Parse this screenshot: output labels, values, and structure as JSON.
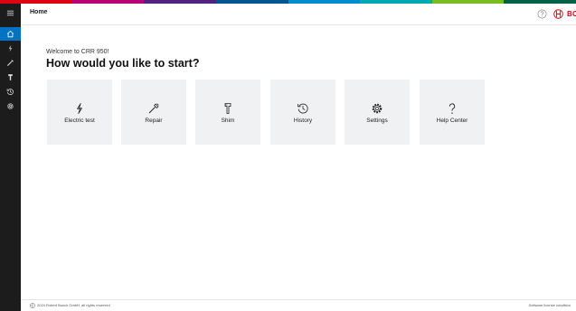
{
  "header": {
    "title": "Home",
    "brand": "BOSCH"
  },
  "brand_colors": {
    "bar": [
      "#e20015",
      "#b90276",
      "#50237f",
      "#005691",
      "#008ecf",
      "#00a8b0",
      "#78be20",
      "#006249"
    ],
    "rail_bg": "#1c1c1c",
    "rail_active": "#0072c3",
    "tile_bg": "#eff1f2",
    "logo_red": "#e20015"
  },
  "sidebar": {
    "items": [
      {
        "icon": "menu-icon"
      },
      {
        "icon": "home-icon",
        "active": true
      },
      {
        "icon": "lightning-icon"
      },
      {
        "icon": "repair-icon"
      },
      {
        "icon": "shim-icon"
      },
      {
        "icon": "history-icon"
      },
      {
        "icon": "settings-icon"
      }
    ]
  },
  "main": {
    "welcome": "Welcome to CRR 950!",
    "headline": "How would you like to start?",
    "tiles": [
      {
        "label": "Electric test",
        "icon": "lightning-icon"
      },
      {
        "label": "Repair",
        "icon": "repair-icon"
      },
      {
        "label": "Shim",
        "icon": "shim-icon"
      },
      {
        "label": "History",
        "icon": "history-icon"
      },
      {
        "label": "Settings",
        "icon": "settings-icon"
      },
      {
        "label": "Help Center",
        "icon": "question-icon"
      }
    ]
  },
  "footer": {
    "copyright": "2024 Robert Bosch GmbH, all rights reserved",
    "license": "Software license condition"
  }
}
